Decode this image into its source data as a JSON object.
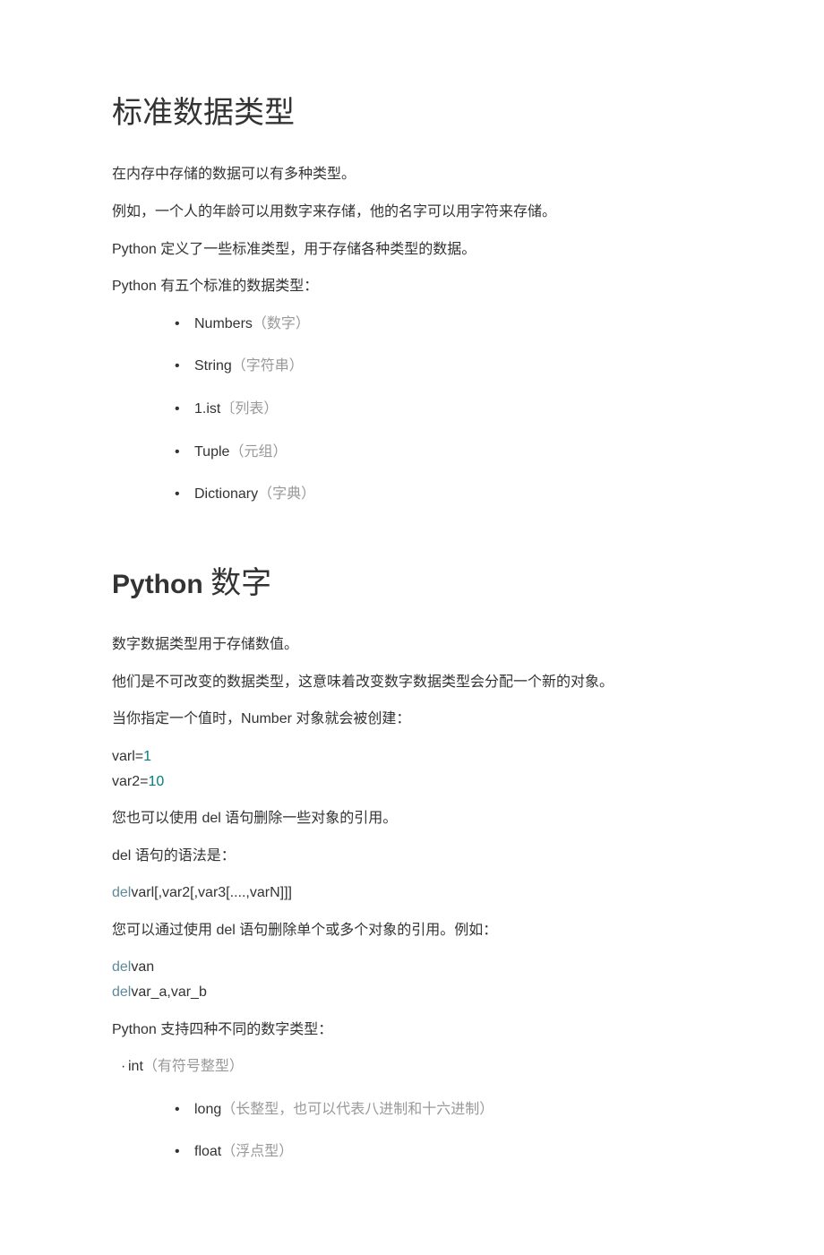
{
  "section1": {
    "title": "标准数据类型",
    "p1": "在内存中存储的数据可以有多种类型。",
    "p2": "例如，一个人的年龄可以用数字来存储，他的名字可以用字符来存储。",
    "p3_latin": "Python",
    "p3_cjk": " 定义了一些标准类型，用于存储各种类型的数据。",
    "p4_latin": "Python",
    "p4_cjk": " 有五个标准的数据类型：",
    "list": [
      {
        "latin": "Numbers",
        "cjk": "（数字）"
      },
      {
        "latin": "String",
        "cjk": "（字符串）"
      },
      {
        "latin": "1.ist",
        "cjk": "〔列表）"
      },
      {
        "latin": "Tuple",
        "cjk": "（元组）"
      },
      {
        "latin": "Dictionary",
        "cjk": "（字典）"
      }
    ]
  },
  "section2": {
    "title_latin": "Python",
    "title_cjk": " 数字",
    "p1": "数字数据类型用于存储数值。",
    "p2": "他们是不可改变的数据类型，这意味着改变数字数据类型会分配一个新的对象。",
    "p3_a": "当你指定一个值时，",
    "p3_latin": "Number",
    "p3_b": " 对象就会被创建：",
    "code1_var1": "varl=",
    "code1_val1": "1",
    "code1_var2": "var2=",
    "code1_val2": "10",
    "p4_a": "您也可以使用 ",
    "p4_latin": "del",
    "p4_b": " 语句删除一些对象的引用。",
    "p5_latin": "del",
    "p5_cjk": " 语句的语法是：",
    "code2_kw": "del",
    "code2_body": "varl[,var2[,var3[....,varN]]]",
    "p6_a": "您可以通过使用 ",
    "p6_latin": "del",
    "p6_b": " 语句删除单个或多个对象的引用。例如：",
    "code3_kw1": "del",
    "code3_body1": "van",
    "code3_kw2": "del",
    "code3_body2": "var_a,var_b",
    "p7_latin": "Python",
    "p7_cjk": " 支持四种不同的数字类型：",
    "list": [
      {
        "latin": "int",
        "cjk": "（有符号整型）",
        "style": "dot"
      },
      {
        "latin": "long",
        "cjk": "（长整型，也可以代表八进制和十六进制）"
      },
      {
        "latin": "float",
        "cjk": "（浮点型）"
      }
    ]
  }
}
